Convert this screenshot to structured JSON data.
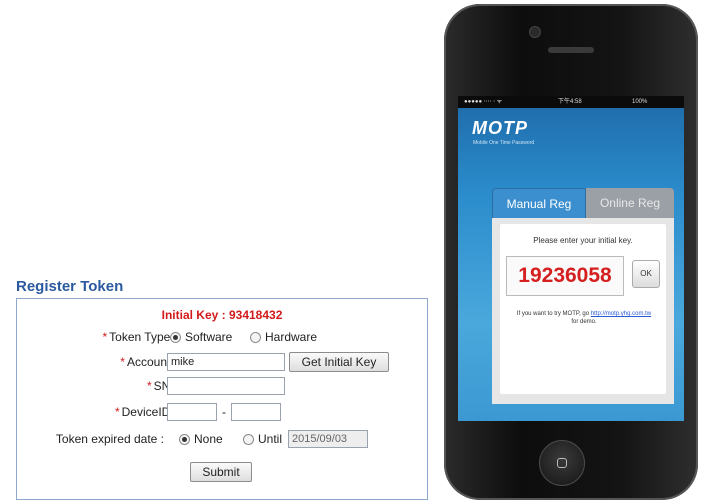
{
  "form": {
    "title": "Register Token",
    "initial_key_text": "Initial Key : 93418432",
    "required_mark": "*",
    "token_type": {
      "label": "Token Type :",
      "options": [
        "Software",
        "Hardware"
      ],
      "selected": "Software"
    },
    "account": {
      "label": "Account :",
      "value": "mike",
      "button_label": "Get Initial Key"
    },
    "sn": {
      "label": "SN :",
      "value": ""
    },
    "device_id": {
      "label": "DeviceID :",
      "value1": "",
      "separator": "-",
      "value2": ""
    },
    "expiry": {
      "label": "Token expired date :",
      "options": [
        "None",
        "Until"
      ],
      "selected": "None",
      "until_value": "2015/09/03"
    },
    "submit_label": "Submit"
  },
  "phone": {
    "status": {
      "carrier": "●●●●● ⋅⋅⋅⋅ ⋅ ᯤ",
      "time": "下午4:58",
      "battery": "100%"
    },
    "brand": "MOTP",
    "brand_tagline": "Mobile One Time Password",
    "tabs": {
      "manual": "Manual Reg",
      "online": "Online Reg"
    },
    "prompt": "Please enter your initial key.",
    "code": "19236058",
    "ok_label": "OK",
    "note_prefix": "If you want to try MOTP, go",
    "note_link": "http://motp.yhg.com.tw",
    "note_suffix": "for demo."
  },
  "colors": {
    "title_blue": "#2c5aa0",
    "required_red": "#d21a1a",
    "screen_blue": "#2b8ccc",
    "code_red": "#d52020"
  },
  "icons": [
    "radio-selected-icon",
    "radio-unselected-icon",
    "home-square-icon"
  ]
}
